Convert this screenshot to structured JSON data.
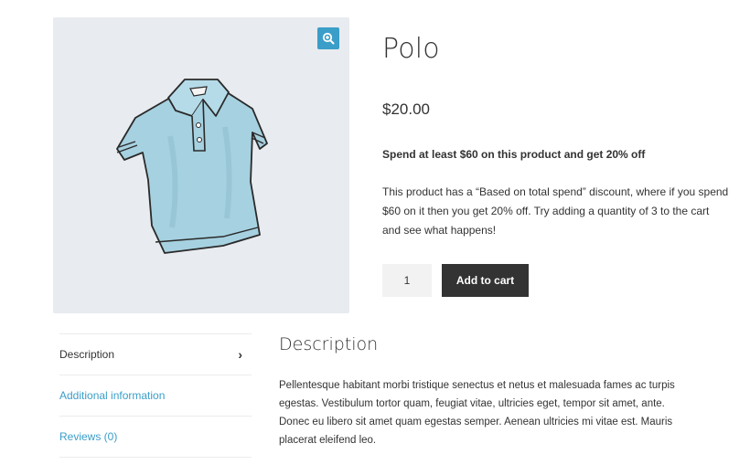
{
  "product": {
    "title": "Polo",
    "price": "$20.00",
    "promo": "Spend at least $60 on this product and get 20% off",
    "description": "This product has a “Based on total spend” discount, where if you spend $60 on it then you get 20% off. Try adding a quantity of 3 to the cart and see what happens!",
    "quantity": "1",
    "add_to_cart_label": "Add to cart"
  },
  "gallery": {
    "zoom_icon": "magnify-plus-icon",
    "background": "#e8ebef",
    "image": "polo-shirt-illustration"
  },
  "tabs": [
    {
      "label": "Description",
      "active": true
    },
    {
      "label": "Additional information",
      "active": false
    },
    {
      "label": "Reviews (0)",
      "active": false
    }
  ],
  "panel": {
    "heading": "Description",
    "text": "Pellentesque habitant morbi tristique senectus et netus et malesuada fames ac turpis egestas. Vestibulum tortor quam, feugiat vitae, ultricies eget, tempor sit amet, ante. Donec eu libero sit amet quam egestas semper. Aenean ultricies mi vitae est. Mauris placerat eleifend leo."
  },
  "colors": {
    "accent": "#3a9ec9",
    "button": "#333333",
    "text": "#333333"
  }
}
